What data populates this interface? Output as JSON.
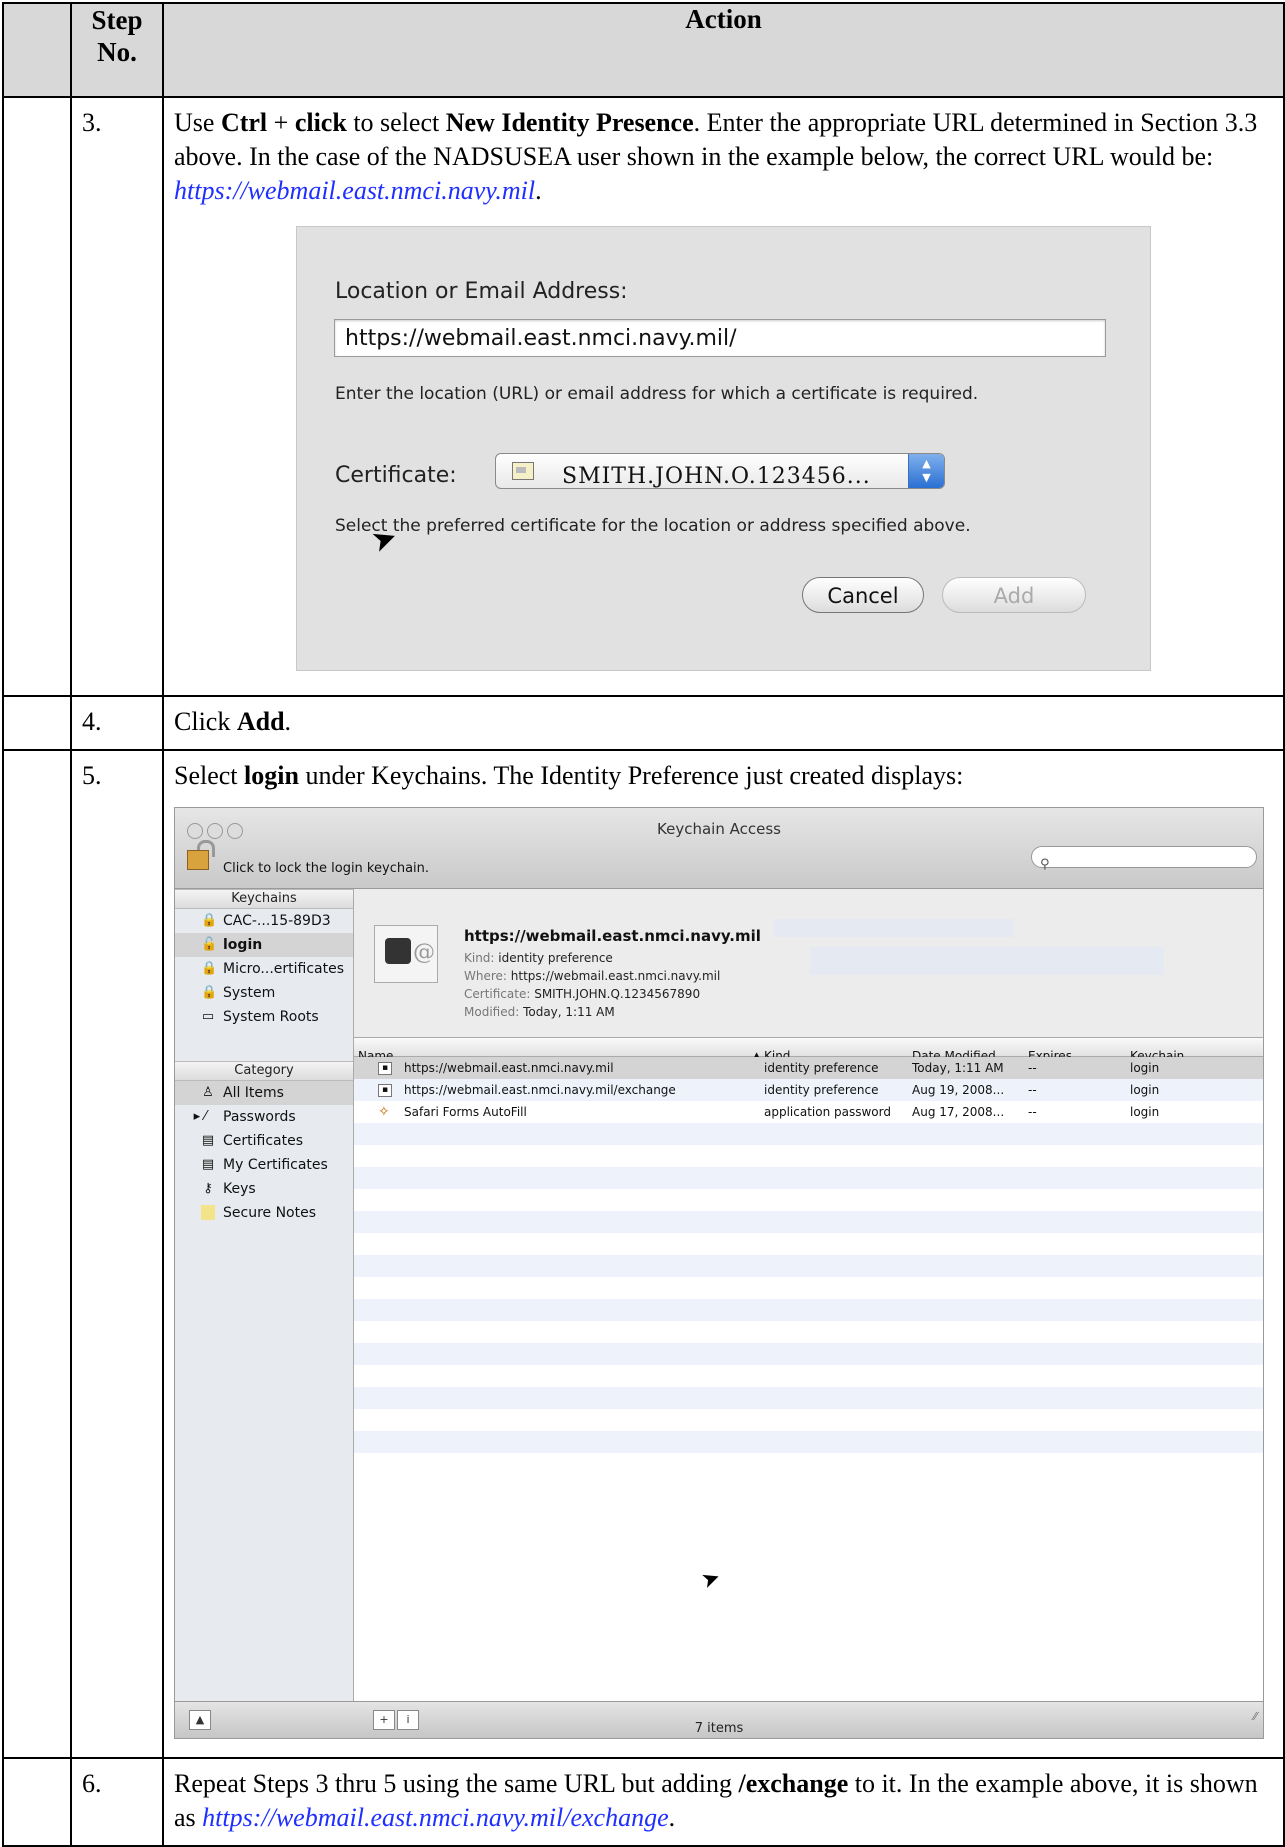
{
  "header": {
    "step_no": "Step No.",
    "action": "Action"
  },
  "steps": [
    {
      "no": "3.",
      "parts": [
        "Use ",
        "Ctrl",
        " + ",
        "click",
        " to select ",
        "New Identity Presence",
        ".  Enter the appropriate URL determined in Section 3.3 above.  In the case of the NADSUSEA user shown in the example below, the correct URL would be:  ",
        "https://webmail.east.nmci.navy.mil",
        "."
      ]
    },
    {
      "no": "4.",
      "parts": [
        "Click ",
        "Add",
        "."
      ]
    },
    {
      "no": "5.",
      "parts": [
        "Select ",
        "login",
        " under Keychains.  The Identity Preference just created displays:"
      ]
    },
    {
      "no": "6.",
      "parts": [
        "Repeat Steps 3 thru 5 using the same URL but adding ",
        "/exchange",
        " to it.  In the example above, it is shown as ",
        "https://webmail.east.nmci.navy.mil/exchange",
        "."
      ]
    }
  ],
  "dialog": {
    "location_label": "Location or Email Address:",
    "location_value": "https://webmail.east.nmci.navy.mil/",
    "location_hint": "Enter the location (URL) or email address for which a certificate is required.",
    "certificate_label": "Certificate:",
    "certificate_value": "SMITH.JOHN.O.123456...",
    "certificate_hint": "Select the preferred certificate for the location or address specified above.",
    "cancel_label": "Cancel",
    "add_label": "Add"
  },
  "keychain_window": {
    "title": "Keychain Access",
    "lock_text": "Click to lock the login keychain.",
    "keychains_header": "Keychains",
    "keychains": [
      {
        "label": "CAC-...15-89D3",
        "icon": "lock-icon"
      },
      {
        "label": "login",
        "icon": "unlock-icon",
        "selected": true
      },
      {
        "label": "Micro...ertificates",
        "icon": "lock-icon"
      },
      {
        "label": "System",
        "icon": "lock-icon"
      },
      {
        "label": "System Roots",
        "icon": "folder-icon"
      }
    ],
    "category_header": "Category",
    "categories": [
      {
        "label": "All Items",
        "icon": "all-items-icon",
        "selected": true
      },
      {
        "label": "Passwords",
        "icon": "passwords-icon"
      },
      {
        "label": "Certificates",
        "icon": "certificate-icon"
      },
      {
        "label": "My Certificates",
        "icon": "my-certificate-icon"
      },
      {
        "label": "Keys",
        "icon": "key-icon"
      },
      {
        "label": "Secure Notes",
        "icon": "note-icon"
      }
    ],
    "detail": {
      "title": "https://webmail.east.nmci.navy.mil",
      "kind_key": "Kind:",
      "kind_val": "identity preference",
      "where_key": "Where:",
      "where_val": "https://webmail.east.nmci.navy.mil",
      "cert_key": "Certificate:",
      "cert_val": "SMITH.JOHN.Q.1234567890",
      "mod_key": "Modified:",
      "mod_val": "Today, 1:11 AM"
    },
    "columns": {
      "name": "Name",
      "kind": "Kind",
      "date": "Date Modified",
      "expires": "Expires",
      "keychain": "Keychain"
    },
    "rows": [
      {
        "name": "https://webmail.east.nmci.navy.mil",
        "kind": "identity preference",
        "date": "Today, 1:11 AM",
        "expires": "--",
        "keychain": "login",
        "selected": true
      },
      {
        "name": "https://webmail.east.nmci.navy.mil/exchange",
        "kind": "identity preference",
        "date": "Aug 19, 2008...",
        "expires": "--",
        "keychain": "login"
      },
      {
        "name": "Safari Forms AutoFill",
        "kind": "application password",
        "date": "Aug 17, 2008...",
        "expires": "--",
        "keychain": "login"
      }
    ],
    "item_count": "7 items"
  },
  "colors": {
    "header_bg": "#d8d8d8",
    "link": "#1f2fff",
    "selection": "#d4d4d4"
  }
}
